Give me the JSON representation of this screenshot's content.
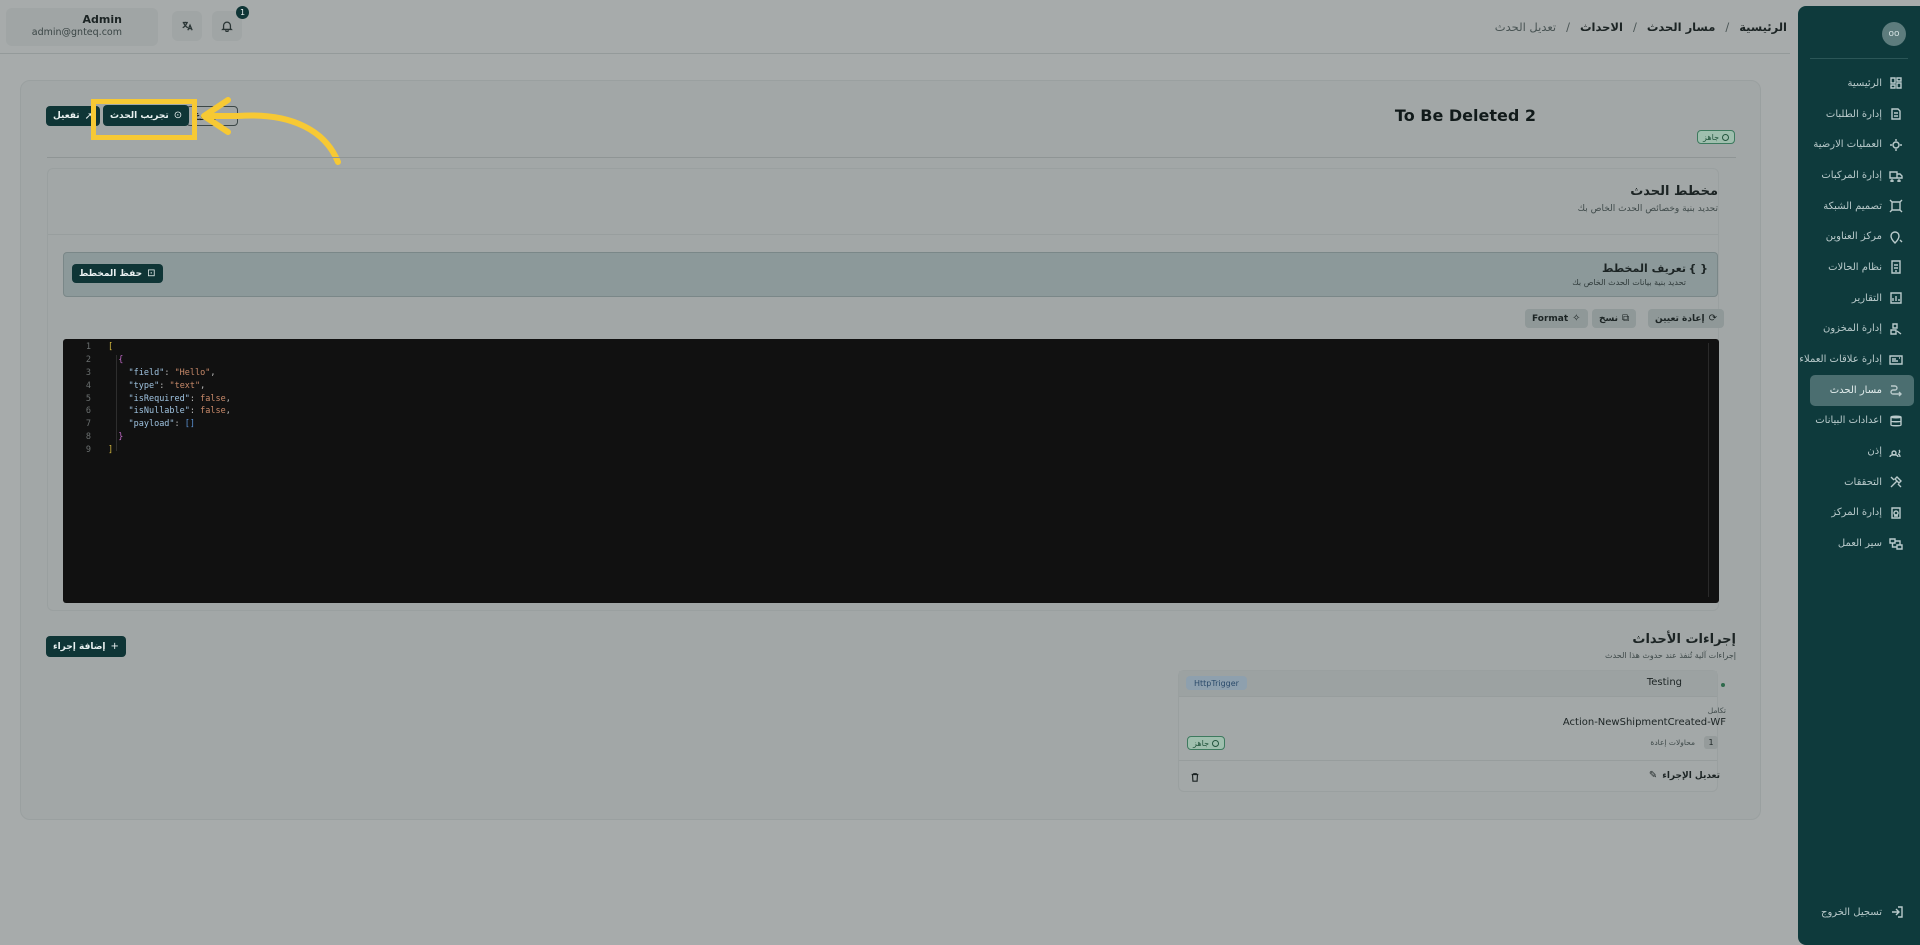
{
  "user": {
    "name": "Admin",
    "email": "admin@gnteq.com"
  },
  "notifications": {
    "count": "1"
  },
  "breadcrumb": {
    "home": "الرئيسية",
    "event_path": "مسار الحدث",
    "events": "الاحداث",
    "current": "تعديل الحدث",
    "separator": "/"
  },
  "sidebar": {
    "avatar": "oo",
    "items": [
      {
        "label": "الرئيسية",
        "icon": "home-icon"
      },
      {
        "label": "إدارة الطلبات",
        "icon": "orders-icon"
      },
      {
        "label": "العمليات الارضية",
        "icon": "ground-ops-icon"
      },
      {
        "label": "إدارة المركبات",
        "icon": "truck-icon"
      },
      {
        "label": "تصميم الشبكة",
        "icon": "network-icon"
      },
      {
        "label": "مركز العناوين",
        "icon": "address-icon"
      },
      {
        "label": "نظام الحالات",
        "icon": "status-system-icon"
      },
      {
        "label": "التقارير",
        "icon": "reports-icon"
      },
      {
        "label": "إدارة المخزون",
        "icon": "inventory-icon"
      },
      {
        "label": "إدارة علاقات العملاء",
        "icon": "crm-icon"
      },
      {
        "label": "مسار الحدث",
        "icon": "event-path-icon"
      },
      {
        "label": "اعدادات البيانات",
        "icon": "database-icon"
      },
      {
        "label": "إذن",
        "icon": "users-icon"
      },
      {
        "label": "التحققات",
        "icon": "tools-icon"
      },
      {
        "label": "إدارة المركز",
        "icon": "center-icon"
      },
      {
        "label": "سير العمل",
        "icon": "workflow-icon"
      }
    ],
    "logout": "تسجيل الخروج"
  },
  "page": {
    "title": "To Be Deleted 2",
    "status": "جاهز"
  },
  "toolbar": {
    "activate": "تفعيل",
    "test_event": "تجريب الحدث",
    "back": "رجوع"
  },
  "schema": {
    "title": "مخطط الحدث",
    "subtitle": "تحديد بنية وخصائص الحدث الخاص بك",
    "definition_title": "تعريف المخطط",
    "definition_subtitle": "تحديد بنية بيانات الحدث الخاص بك",
    "definition_icon": "{ }",
    "save": "حفظ المخطط",
    "reset": "إعادة تعيين",
    "copy": "نسخ",
    "format": "Format"
  },
  "editor": {
    "line_numbers": [
      "1",
      "2",
      "3",
      "4",
      "5",
      "6",
      "7",
      "8",
      "9"
    ]
  },
  "actions": {
    "title": "إجراءات الأحداث",
    "subtitle": "إجراءات آلية تُنفذ عند حدوث هذا الحدث",
    "add": "إضافة إجراء",
    "item": {
      "trigger": "HttpTrigger",
      "name": "Testing",
      "label": "تكامل",
      "workflow": "Action-NewShipmentCreated-WF",
      "retry_count": "1",
      "retry_label": "محاولات إعادة",
      "status": "جاهز",
      "edit": "تعديل الإجراء"
    }
  },
  "colors": {
    "accent": "#0f3536",
    "highlight": "#f7c934",
    "sidebar": "#0e3a3c",
    "editor_bg": "#111111"
  }
}
